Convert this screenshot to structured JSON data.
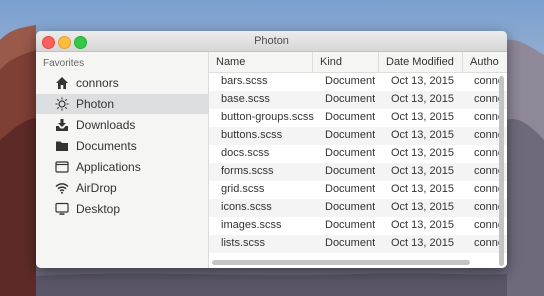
{
  "window": {
    "title": "Photon"
  },
  "sidebar": {
    "heading": "Favorites",
    "items": [
      {
        "label": "connors",
        "icon": "home-icon",
        "active": false
      },
      {
        "label": "Photon",
        "icon": "sun-icon",
        "active": true
      },
      {
        "label": "Downloads",
        "icon": "download-icon",
        "active": false
      },
      {
        "label": "Documents",
        "icon": "folder-icon",
        "active": false
      },
      {
        "label": "Applications",
        "icon": "window-icon",
        "active": false
      },
      {
        "label": "AirDrop",
        "icon": "wifi-icon",
        "active": false
      },
      {
        "label": "Desktop",
        "icon": "monitor-icon",
        "active": false
      }
    ]
  },
  "table": {
    "columns": [
      "Name",
      "Kind",
      "Date Modified",
      "Autho"
    ],
    "rows": [
      [
        "bars.scss",
        "Document",
        "Oct 13, 2015",
        "conno"
      ],
      [
        "base.scss",
        "Document",
        "Oct 13, 2015",
        "conno"
      ],
      [
        "button-groups.scss",
        "Document",
        "Oct 13, 2015",
        "conno"
      ],
      [
        "buttons.scss",
        "Document",
        "Oct 13, 2015",
        "conno"
      ],
      [
        "docs.scss",
        "Document",
        "Oct 13, 2015",
        "conno"
      ],
      [
        "forms.scss",
        "Document",
        "Oct 13, 2015",
        "conno"
      ],
      [
        "grid.scss",
        "Document",
        "Oct 13, 2015",
        "conno"
      ],
      [
        "icons.scss",
        "Document",
        "Oct 13, 2015",
        "conno"
      ],
      [
        "images.scss",
        "Document",
        "Oct 13, 2015",
        "conno"
      ],
      [
        "lists.scss",
        "Document",
        "Oct 13, 2015",
        "conno"
      ]
    ]
  }
}
